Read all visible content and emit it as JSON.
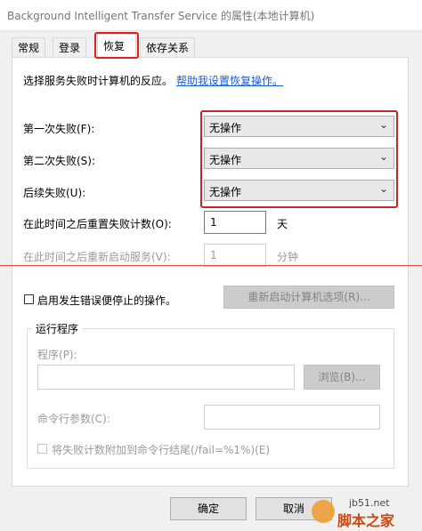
{
  "window": {
    "title": "Background Intelligent Transfer Service 的属性(本地计算机)"
  },
  "tabs": [
    {
      "label": "常规"
    },
    {
      "label": "登录"
    },
    {
      "label": "恢复"
    },
    {
      "label": "依存关系"
    }
  ],
  "recovery": {
    "description": "选择服务失败时计算机的反应。",
    "help_link": "帮助我设置恢复操作。",
    "first_failure_label": "第一次失败(F):",
    "first_failure_value": "无操作",
    "second_failure_label": "第二次失败(S):",
    "second_failure_value": "无操作",
    "subsequent_failure_label": "后续失败(U):",
    "subsequent_failure_value": "无操作",
    "reset_count_label": "在此时间之后重置失败计数(O):",
    "reset_count_value": "1",
    "reset_count_unit": "天",
    "restart_service_label": "在此时间之后重新启动服务(V):",
    "restart_service_value": "1",
    "restart_service_unit": "分钟",
    "enable_actions_label": "启用发生错误便停止的操作。",
    "restart_options_button": "重新启动计算机选项(R)...",
    "run_program_group": "运行程序",
    "program_label": "程序(P):",
    "browse_button": "浏览(B)...",
    "cmd_params_label": "命令行参数(C):",
    "append_fail_label": "将失败计数附加到命令行结尾(/fail=%1%)(E)"
  },
  "footer": {
    "ok_button": "确定",
    "cancel_button": "取消"
  },
  "watermark": {
    "site": "jb51.net",
    "brand": "脚本之家"
  },
  "colors": {
    "highlight_red": "#e02020",
    "link_blue": "#1a5bd6"
  },
  "icons": {
    "dropdown": "chevron-down-icon"
  }
}
